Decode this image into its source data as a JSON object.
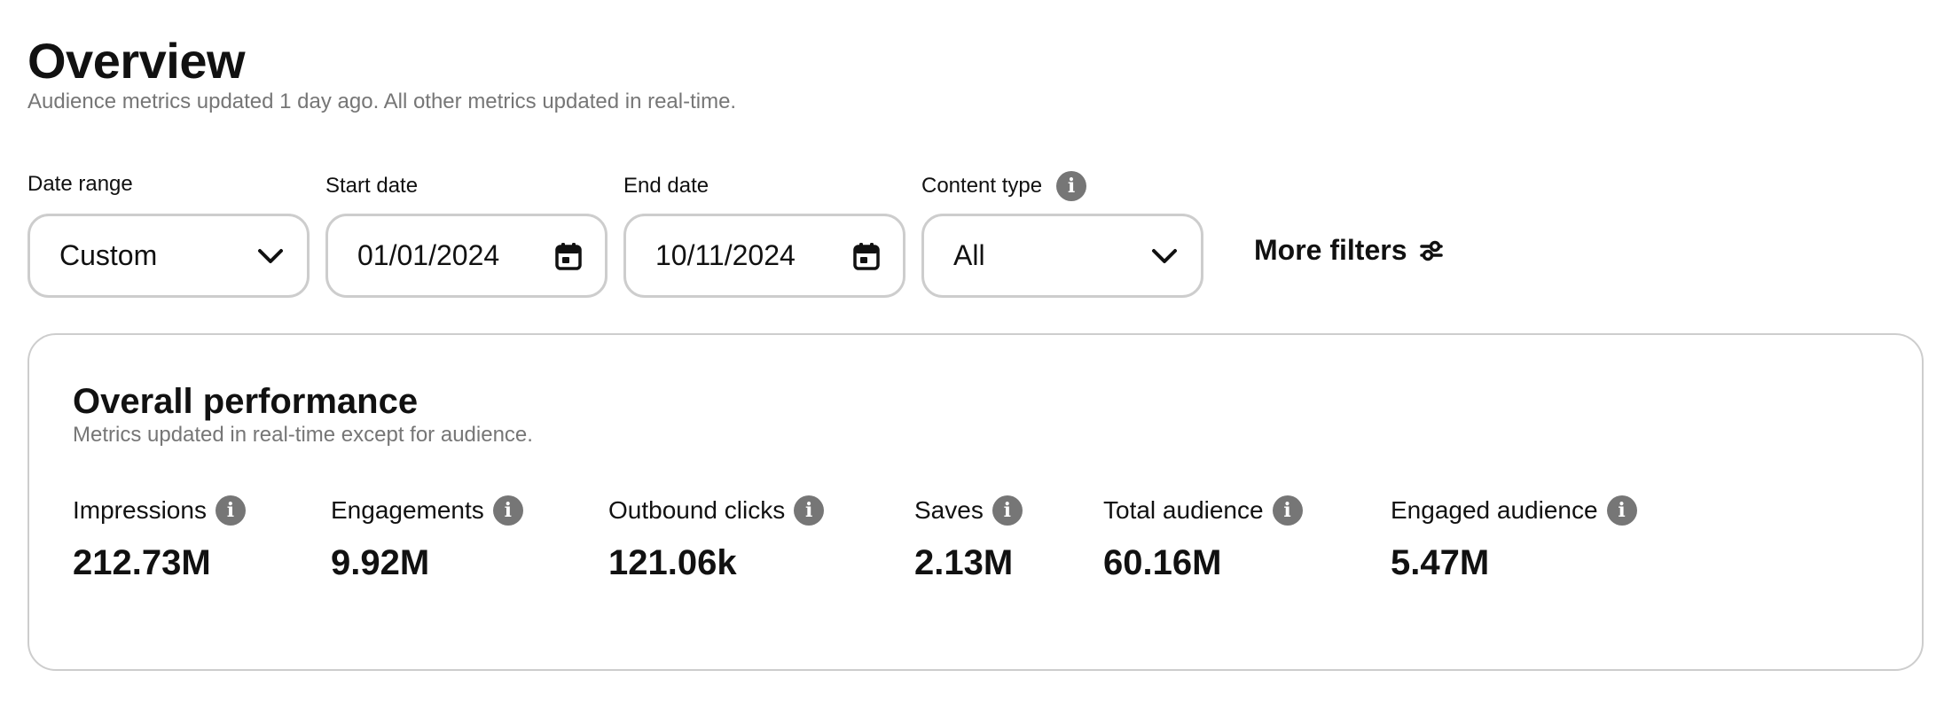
{
  "header": {
    "title": "Overview",
    "subtitle": "Audience metrics updated 1 day ago. All other metrics updated in real-time."
  },
  "filters": {
    "date_range": {
      "label": "Date range",
      "value": "Custom",
      "icon": "chevron-down-icon"
    },
    "start_date": {
      "label": "Start date",
      "value": "01/01/2024",
      "icon": "calendar-icon"
    },
    "end_date": {
      "label": "End date",
      "value": "10/11/2024",
      "icon": "calendar-icon"
    },
    "content_type": {
      "label": "Content type",
      "value": "All",
      "icon": "chevron-down-icon",
      "info_icon": "info-icon"
    },
    "more_filters": {
      "label": "More filters",
      "icon": "sliders-icon"
    }
  },
  "performance": {
    "title": "Overall performance",
    "subtitle": "Metrics updated in real-time except for audience.",
    "metrics": [
      {
        "label": "Impressions",
        "value": "212.73M"
      },
      {
        "label": "Engagements",
        "value": "9.92M"
      },
      {
        "label": "Outbound clicks",
        "value": "121.06k"
      },
      {
        "label": "Saves",
        "value": "2.13M"
      },
      {
        "label": "Total audience",
        "value": "60.16M"
      },
      {
        "label": "Engaged audience",
        "value": "5.47M"
      }
    ]
  },
  "colors": {
    "text_primary": "#111111",
    "text_secondary": "#767676",
    "border": "#cdcdcd",
    "info_icon_bg": "#767676"
  }
}
